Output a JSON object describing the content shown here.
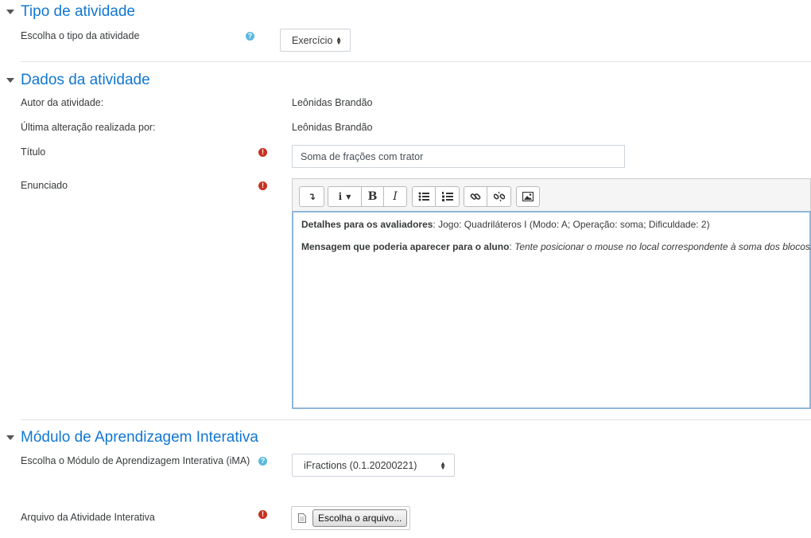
{
  "sections": {
    "activity_type": {
      "title": "Tipo de atividade",
      "choose_label": "Escolha o tipo da atividade",
      "choose_value": "Exercício"
    },
    "activity_data": {
      "title": "Dados da atividade",
      "author_label": "Autor da atividade:",
      "author_value": "Leônidas Brandão",
      "last_edit_label": "Última alteração realizada por:",
      "last_edit_value": "Leônidas Brandão",
      "title_label": "Título",
      "title_value": "Soma de frações com trator",
      "statement_label": "Enunciado"
    },
    "ima": {
      "title": "Módulo de Aprendizagem Interativa",
      "choose_label": "Escolha o Módulo de Aprendizagem Interativa (iMA)",
      "choose_value": "iFractions (0.1.20200221)",
      "file_label": "Arquivo da Atividade Interativa",
      "file_button": "Escolha o arquivo..."
    }
  },
  "editor": {
    "line1_bold": "Detalhes para os avaliadores",
    "line1_rest": ": Jogo: Quadriláteros I (Modo: A; Operação: soma; Dificuldade: 2)",
    "line2_bold": "Mensagem que poderia aparecer para o aluno",
    "line2_sep": ": ",
    "line2_italic": "Tente posicionar o mouse no local correspondente à soma dos blocos.",
    "toolbar": {
      "collapse_icon": "↴",
      "info_icon": "i",
      "bold": "B",
      "italic": "I"
    }
  },
  "icons": {
    "help": "?",
    "required": "!"
  },
  "colors": {
    "section_title": "#1177d1",
    "help_icon": "#5bb8e0",
    "required_icon": "#ca3120",
    "editor_border": "#8fb6d8"
  }
}
